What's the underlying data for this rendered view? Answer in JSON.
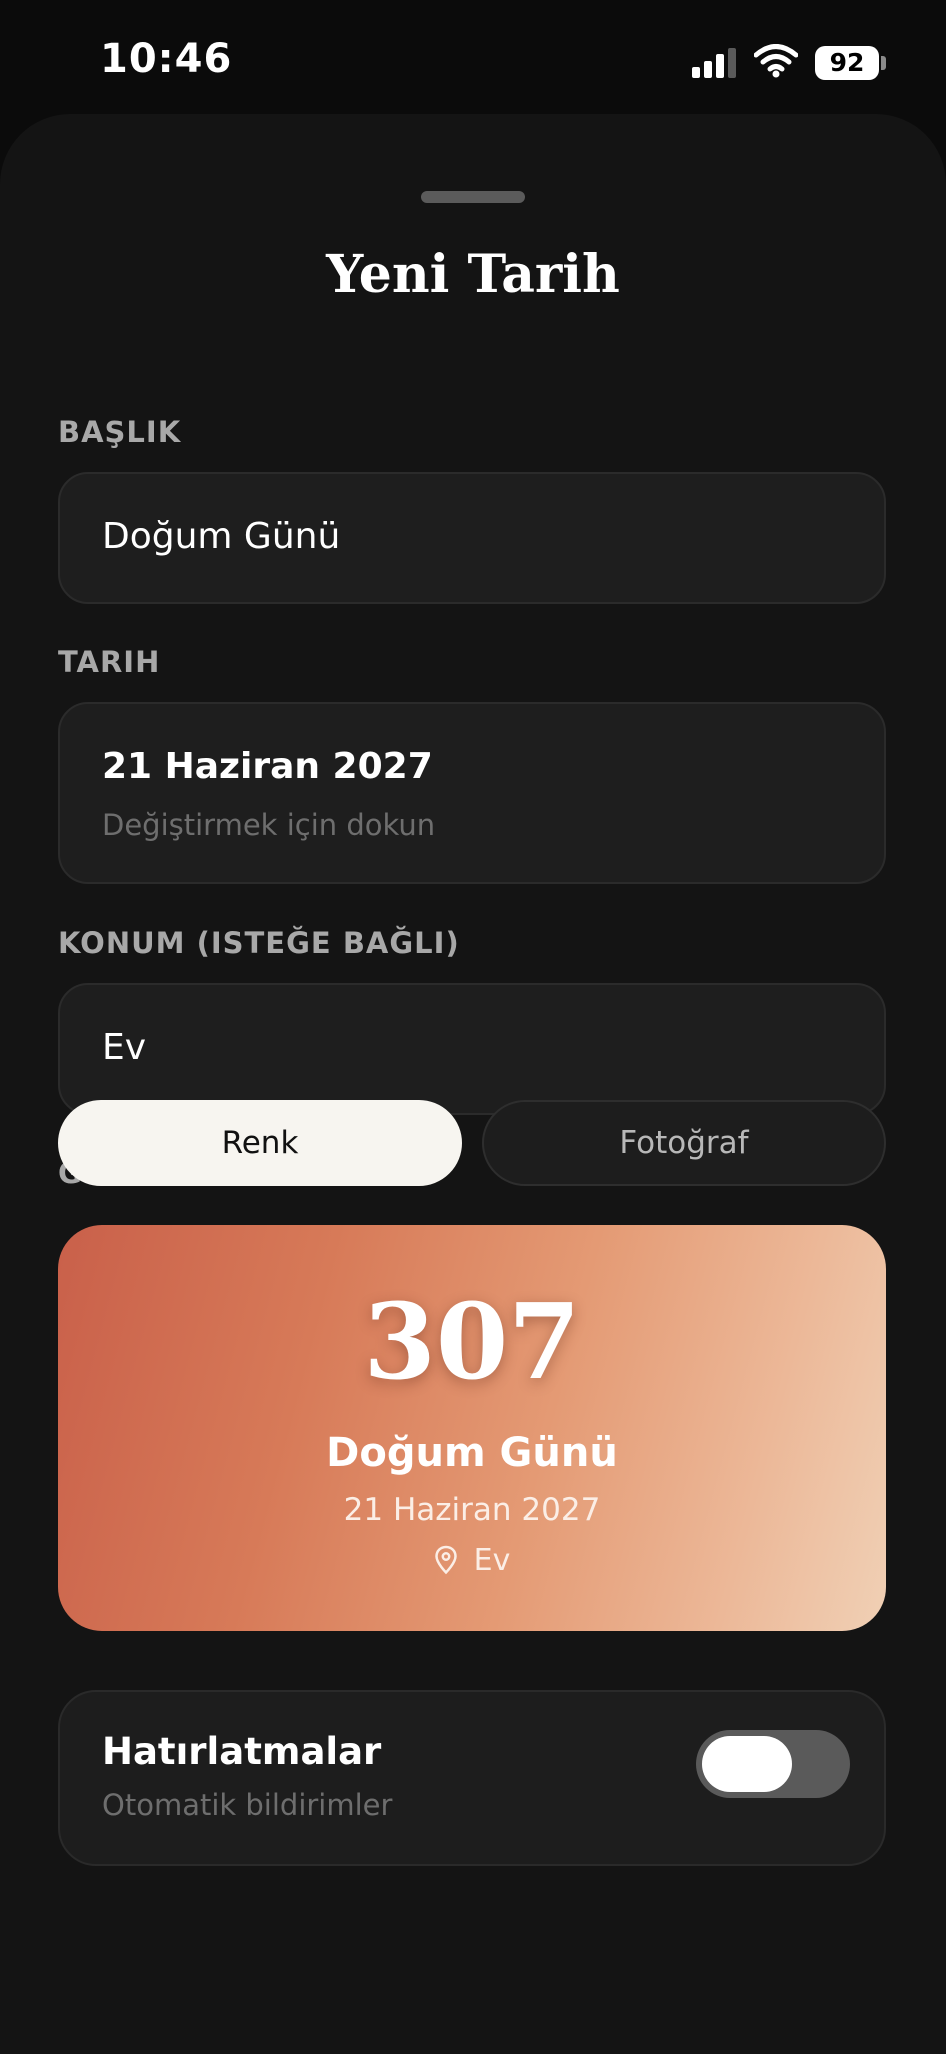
{
  "status_bar": {
    "time": "10:46",
    "battery": "92"
  },
  "sheet": {
    "title": "Yeni Tarih"
  },
  "fields": {
    "title_label": "BAŞLIK",
    "title_value": "Doğum Günü",
    "date_label": "TARIH",
    "date_value": "21 Haziran 2027",
    "date_hint": "Değiştirmek için dokun",
    "location_label": "KONUM (ISTEĞE BAĞLI)",
    "location_value": "Ev"
  },
  "appearance": {
    "label": "GÖRÜNÜM",
    "options": [
      "Renk",
      "Fotoğraf"
    ],
    "selected": "Renk"
  },
  "preview": {
    "count": "307",
    "title": "Doğum Günü",
    "date": "21 Haziran 2027",
    "location": "Ev",
    "gradient_colors": [
      "#c9604a",
      "#e49a74",
      "#f0d0b5"
    ]
  },
  "reminders": {
    "title": "Hatırlatmalar",
    "subtitle": "Otomatik bildirimler",
    "enabled": false
  },
  "icons": [
    "signal-icon",
    "wifi-icon",
    "battery-icon",
    "location-pin-icon"
  ]
}
